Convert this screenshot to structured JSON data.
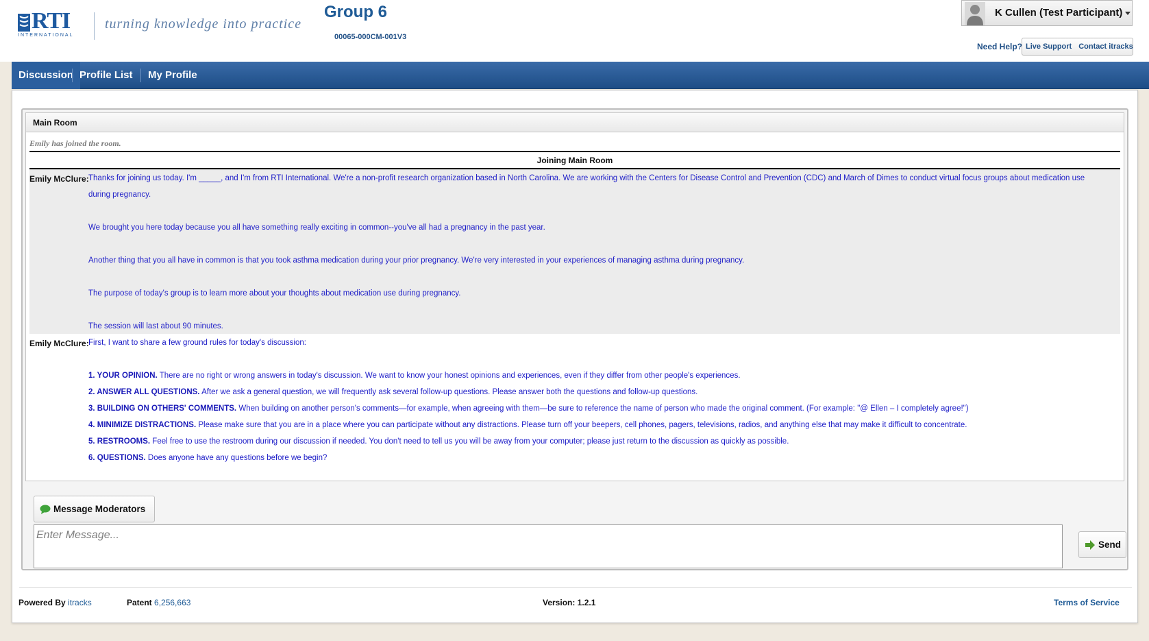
{
  "header": {
    "logo_text": "RTI",
    "logo_sub": "INTERNATIONAL",
    "tagline": "turning knowledge into practice",
    "group_title": "Group 6",
    "group_code": "00065-000CM-001V3",
    "user_name": "K Cullen (Test Participant)",
    "help_label": "Need Help?",
    "help_links": [
      "Live Support",
      "Contact itracks"
    ]
  },
  "nav": {
    "items": [
      "Discussion",
      "Profile List",
      "My Profile"
    ],
    "active": "Discussion"
  },
  "room": {
    "title": "Main Room",
    "joined_note": "Emily has joined the room.",
    "section_title": "Joining Main Room",
    "messages": [
      {
        "author": "Emily McClure:",
        "lines": [
          "Thanks for joining us today. I'm _____, and I'm from RTI International. We're a non-profit research organization based in North Carolina. We are working with the Centers for Disease Control and Prevention (CDC) and March of Dimes to conduct virtual focus groups about medication use",
          "during pregnancy.",
          "We brought you here today because you all have something really exciting in common--you've all had a pregnancy in the past year.",
          "Another thing that you all have in common is that you took asthma medication during your prior pregnancy. We're very interested in your experiences of managing asthma during pregnancy.",
          "The purpose of today's group is to learn more about your thoughts about medication use during pregnancy.",
          "The session will last about 90 minutes."
        ]
      },
      {
        "author": "Emily McClure:",
        "intro": "First, I want to share a few ground rules for today's discussion:",
        "rules": [
          {
            "head": "1. YOUR OPINION.",
            "text": " There are no right or wrong answers in today's discussion. We want to know your honest opinions and experiences, even if they differ from other people's experiences."
          },
          {
            "head": "2. ANSWER ALL QUESTIONS.",
            "text": " After we ask a general question, we will frequently ask several follow-up questions. Please answer both the questions and follow-up questions."
          },
          {
            "head": "3. BUILDING ON OTHERS' COMMENTS.",
            "text": " When building on another person's comments—for example, when agreeing with them—be sure to reference the name of person who made the original comment. (For example: \"@ Ellen – I completely agree!\")"
          },
          {
            "head": "4. MINIMIZE DISTRACTIONS.",
            "text": " Please make sure that you are in a place where you can participate without any distractions. Please turn off your beepers, cell phones, pagers, televisions, radios, and anything else that may make it difficult to concentrate."
          },
          {
            "head": "5. RESTROOMS.",
            "text": " Feel free to use the restroom during our discussion if needed. You don't need to tell us you will be away from your computer; please just return to the discussion as quickly as possible."
          },
          {
            "head": "6. QUESTIONS.",
            "text": " Does anyone have any questions before we begin?"
          }
        ]
      }
    ]
  },
  "compose": {
    "moderator_button": "Message Moderators",
    "placeholder": "Enter Message...",
    "send_button": "Send"
  },
  "footer": {
    "powered_label": "Powered By",
    "powered_link": "itracks",
    "patent_label": "Patent",
    "patent_number": "6,256,663",
    "version": "Version: 1.2.1",
    "terms": "Terms of Service"
  },
  "colors": {
    "brand_blue": "#1f5b96",
    "message_text": "#2020c8",
    "nav_bg": "#1d4d86"
  }
}
